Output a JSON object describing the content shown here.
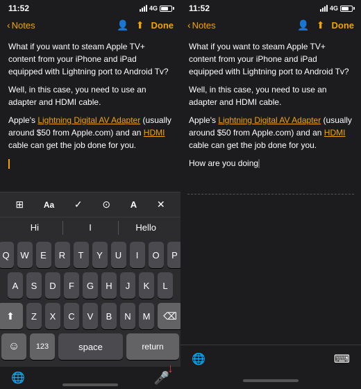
{
  "left_panel": {
    "status": {
      "time": "11:52",
      "network": "4G"
    },
    "nav": {
      "back_label": "Notes",
      "done_label": "Done"
    },
    "note": {
      "paragraph1": "What if you want to steam Apple TV+ content from your iPhone and iPad equipped with Lightning port to Android Tv?",
      "paragraph2": "Well, in this case, you need to use an adapter and HDMI cable.",
      "paragraph3_pre": "Apple's ",
      "paragraph3_link1": "Lightning Digital AV Adapter",
      "paragraph3_mid": " (usually around $50 from Apple.com) and an ",
      "paragraph3_link2": "HDMI",
      "paragraph3_post": " cable can get the job done for you."
    },
    "toolbar": {
      "icons": [
        "⊞",
        "Aa",
        "✓",
        "📷",
        "A",
        "✕"
      ]
    },
    "predictive": {
      "words": [
        "Hi",
        "I",
        "Hello"
      ]
    },
    "keyboard": {
      "row1": [
        "Q",
        "W",
        "E",
        "R",
        "T",
        "Y",
        "U",
        "I",
        "O",
        "P"
      ],
      "row2": [
        "A",
        "S",
        "D",
        "F",
        "G",
        "H",
        "J",
        "K",
        "L"
      ],
      "row3": [
        "Z",
        "X",
        "C",
        "V",
        "B",
        "N",
        "M"
      ],
      "space_label": "space",
      "return_label": "return",
      "num_label": "123"
    }
  },
  "right_panel": {
    "status": {
      "time": "11:52",
      "network": "4G"
    },
    "nav": {
      "back_label": "Notes",
      "done_label": "Done"
    },
    "note": {
      "paragraph1": "What if you want to steam Apple TV+ content from your iPhone and iPad equipped with Lightning port to Android Tv?",
      "paragraph2": "Well, in this case, you need to use an adapter and HDMI cable.",
      "paragraph3_pre": "Apple's ",
      "paragraph3_link1": "Lightning Digital AV Adapter",
      "paragraph3_mid": " (usually around $50 from Apple.com) and an ",
      "paragraph3_link2": "HDMI",
      "paragraph3_post": " cable can get the job done for you.",
      "paragraph4": "How are you doing"
    }
  }
}
